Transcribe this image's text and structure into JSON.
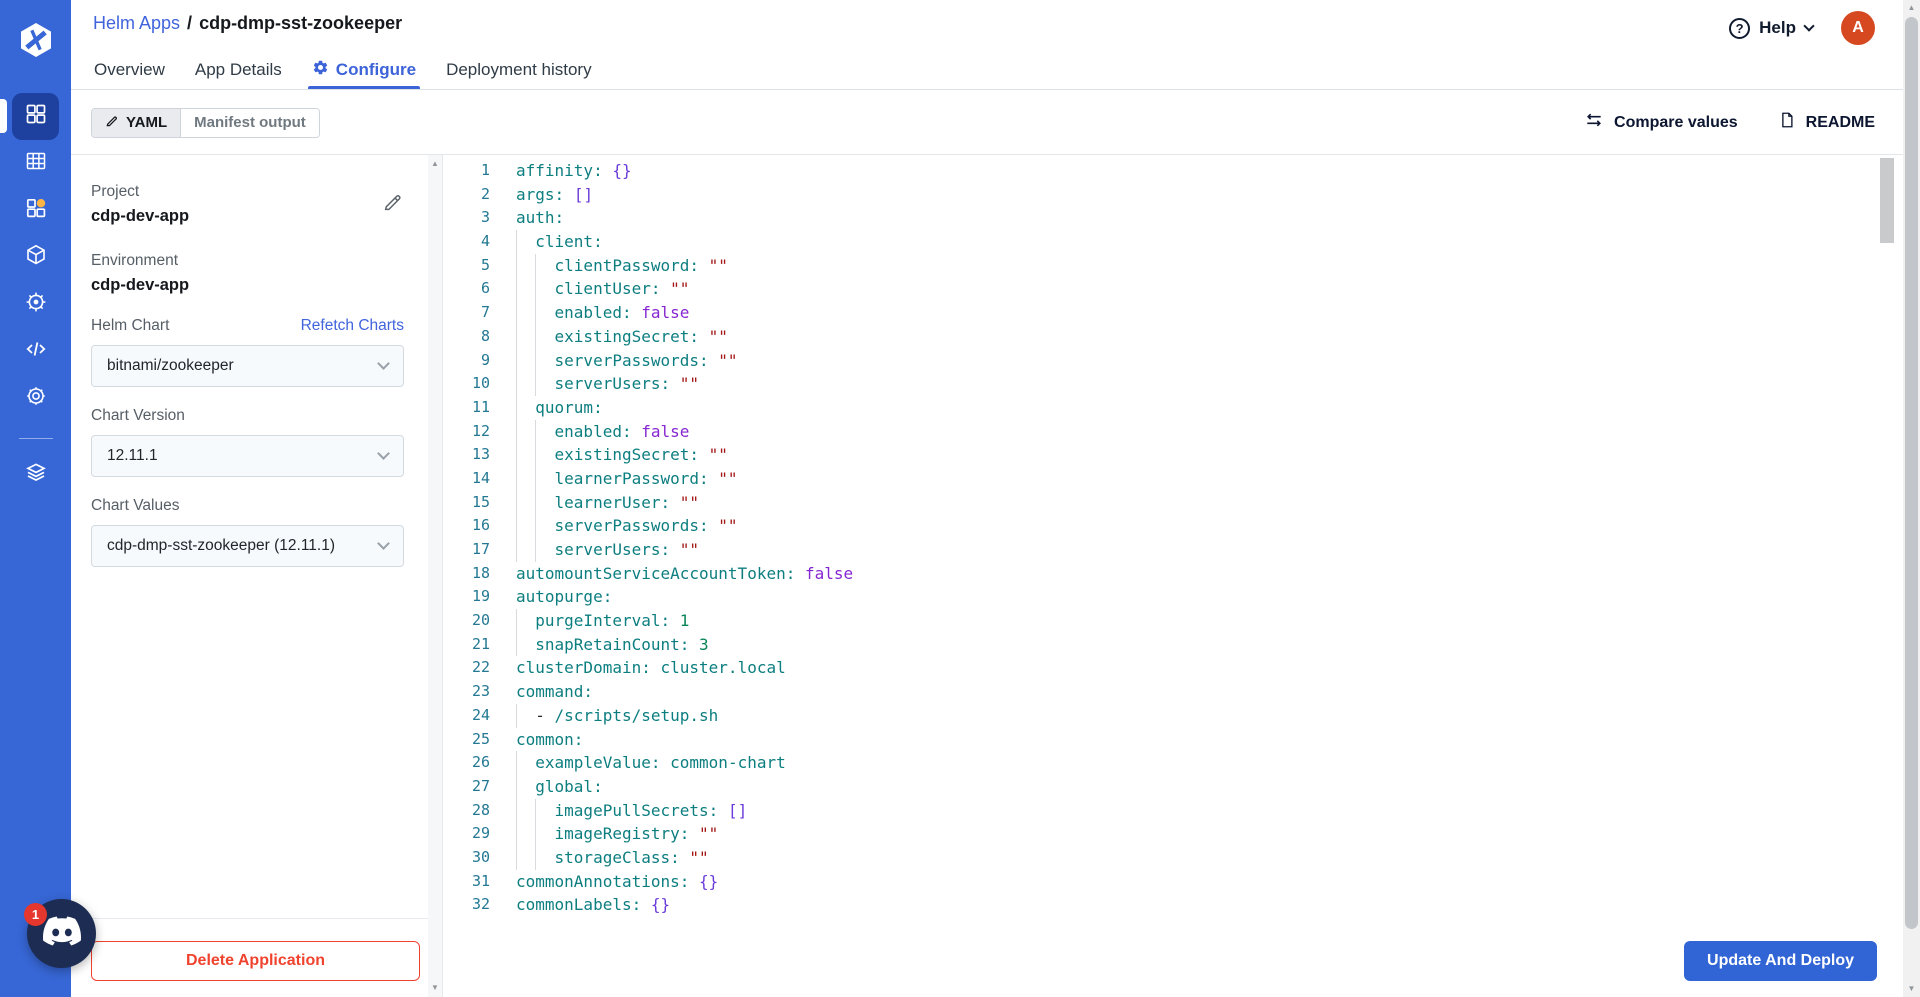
{
  "colors": {
    "rail_blue": "#3767d6",
    "rail_active": "#1e409e",
    "link_blue": "#4164dd",
    "tab_active": "#3d63d8",
    "deploy_blue": "#3165d6",
    "danger_red": "#f0432e",
    "avatar_orange": "#d6481f",
    "badge_red": "#e5372e",
    "notification_dot": "#ffb545",
    "yaml_key_teal": "#0d7e80",
    "yaml_string_red": "#a31515",
    "yaml_number_green": "#098658",
    "yaml_keyword_purple": "#8626d1",
    "yaml_bracket_purple": "#6a3bd8",
    "line_number": "#237893"
  },
  "icons": {
    "logo": "devtron-logo",
    "rail": [
      "apps-grid-icon",
      "jobs-table-icon",
      "chart-store-icon",
      "resource-cube-icon",
      "security-wheel-icon",
      "code-icon",
      "gear-icon",
      "stack-icon"
    ],
    "help_question": "?",
    "up_arrow": "▲",
    "down_arrow": "▼"
  },
  "header": {
    "breadcrumb": {
      "parent": "Helm Apps",
      "separator": "/",
      "current": "cdp-dmp-sst-zookeeper"
    },
    "help_label": "Help",
    "avatar_initial": "A"
  },
  "tabs": [
    {
      "label": "Overview",
      "active": false
    },
    {
      "label": "App Details",
      "active": false
    },
    {
      "label": "Configure",
      "active": true
    },
    {
      "label": "Deployment history",
      "active": false
    }
  ],
  "toolbar": {
    "yaml_label": "YAML",
    "manifest_label": "Manifest output",
    "compare_label": "Compare values",
    "readme_label": "README"
  },
  "panel": {
    "project_label": "Project",
    "project_value": "cdp-dev-app",
    "environment_label": "Environment",
    "environment_value": "cdp-dev-app",
    "helm_chart_label": "Helm Chart",
    "refetch_label": "Refetch Charts",
    "helm_chart_value": "bitnami/zookeeper",
    "chart_version_label": "Chart Version",
    "chart_version_value": "12.11.1",
    "chart_values_label": "Chart Values",
    "chart_values_value": "cdp-dmp-sst-zookeeper (12.11.1)",
    "delete_label": "Delete Application"
  },
  "footer": {
    "deploy_label": "Update And Deploy"
  },
  "floating": {
    "badge": "1"
  },
  "editor": {
    "lines": [
      {
        "indent": 0,
        "tokens": [
          [
            "k",
            "affinity:"
          ],
          [
            "t",
            " "
          ],
          [
            "b",
            "{}"
          ]
        ]
      },
      {
        "indent": 0,
        "tokens": [
          [
            "k",
            "args:"
          ],
          [
            "t",
            " "
          ],
          [
            "b",
            "[]"
          ]
        ]
      },
      {
        "indent": 0,
        "tokens": [
          [
            "k",
            "auth:"
          ]
        ]
      },
      {
        "indent": 1,
        "tokens": [
          [
            "k",
            "client:"
          ]
        ]
      },
      {
        "indent": 2,
        "tokens": [
          [
            "k",
            "clientPassword:"
          ],
          [
            "t",
            " "
          ],
          [
            "s",
            "\"\""
          ]
        ]
      },
      {
        "indent": 2,
        "tokens": [
          [
            "k",
            "clientUser:"
          ],
          [
            "t",
            " "
          ],
          [
            "s",
            "\"\""
          ]
        ]
      },
      {
        "indent": 2,
        "tokens": [
          [
            "k",
            "enabled:"
          ],
          [
            "t",
            " "
          ],
          [
            "w",
            "false"
          ]
        ]
      },
      {
        "indent": 2,
        "tokens": [
          [
            "k",
            "existingSecret:"
          ],
          [
            "t",
            " "
          ],
          [
            "s",
            "\"\""
          ]
        ]
      },
      {
        "indent": 2,
        "tokens": [
          [
            "k",
            "serverPasswords:"
          ],
          [
            "t",
            " "
          ],
          [
            "s",
            "\"\""
          ]
        ]
      },
      {
        "indent": 2,
        "tokens": [
          [
            "k",
            "serverUsers:"
          ],
          [
            "t",
            " "
          ],
          [
            "s",
            "\"\""
          ]
        ]
      },
      {
        "indent": 1,
        "tokens": [
          [
            "k",
            "quorum:"
          ]
        ]
      },
      {
        "indent": 2,
        "tokens": [
          [
            "k",
            "enabled:"
          ],
          [
            "t",
            " "
          ],
          [
            "w",
            "false"
          ]
        ]
      },
      {
        "indent": 2,
        "tokens": [
          [
            "k",
            "existingSecret:"
          ],
          [
            "t",
            " "
          ],
          [
            "s",
            "\"\""
          ]
        ]
      },
      {
        "indent": 2,
        "tokens": [
          [
            "k",
            "learnerPassword:"
          ],
          [
            "t",
            " "
          ],
          [
            "s",
            "\"\""
          ]
        ]
      },
      {
        "indent": 2,
        "tokens": [
          [
            "k",
            "learnerUser:"
          ],
          [
            "t",
            " "
          ],
          [
            "s",
            "\"\""
          ]
        ]
      },
      {
        "indent": 2,
        "tokens": [
          [
            "k",
            "serverPasswords:"
          ],
          [
            "t",
            " "
          ],
          [
            "s",
            "\"\""
          ]
        ]
      },
      {
        "indent": 2,
        "tokens": [
          [
            "k",
            "serverUsers:"
          ],
          [
            "t",
            " "
          ],
          [
            "s",
            "\"\""
          ]
        ]
      },
      {
        "indent": 0,
        "tokens": [
          [
            "k",
            "automountServiceAccountToken:"
          ],
          [
            "t",
            " "
          ],
          [
            "w",
            "false"
          ]
        ]
      },
      {
        "indent": 0,
        "tokens": [
          [
            "k",
            "autopurge:"
          ]
        ]
      },
      {
        "indent": 1,
        "tokens": [
          [
            "k",
            "purgeInterval:"
          ],
          [
            "t",
            " "
          ],
          [
            "n",
            "1"
          ]
        ]
      },
      {
        "indent": 1,
        "tokens": [
          [
            "k",
            "snapRetainCount:"
          ],
          [
            "t",
            " "
          ],
          [
            "n",
            "3"
          ]
        ]
      },
      {
        "indent": 0,
        "tokens": [
          [
            "k",
            "clusterDomain:"
          ],
          [
            "t",
            " "
          ],
          [
            "v",
            "cluster.local"
          ]
        ]
      },
      {
        "indent": 0,
        "tokens": [
          [
            "k",
            "command:"
          ]
        ]
      },
      {
        "indent": 1,
        "tokens": [
          [
            "t",
            "- "
          ],
          [
            "v",
            "/scripts/setup.sh"
          ]
        ]
      },
      {
        "indent": 0,
        "tokens": [
          [
            "k",
            "common:"
          ]
        ]
      },
      {
        "indent": 1,
        "tokens": [
          [
            "k",
            "exampleValue:"
          ],
          [
            "t",
            " "
          ],
          [
            "v",
            "common-chart"
          ]
        ]
      },
      {
        "indent": 1,
        "tokens": [
          [
            "k",
            "global:"
          ]
        ]
      },
      {
        "indent": 2,
        "tokens": [
          [
            "k",
            "imagePullSecrets:"
          ],
          [
            "t",
            " "
          ],
          [
            "b",
            "[]"
          ]
        ]
      },
      {
        "indent": 2,
        "tokens": [
          [
            "k",
            "imageRegistry:"
          ],
          [
            "t",
            " "
          ],
          [
            "s",
            "\"\""
          ]
        ]
      },
      {
        "indent": 2,
        "tokens": [
          [
            "k",
            "storageClass:"
          ],
          [
            "t",
            " "
          ],
          [
            "s",
            "\"\""
          ]
        ]
      },
      {
        "indent": 0,
        "tokens": [
          [
            "k",
            "commonAnnotations:"
          ],
          [
            "t",
            " "
          ],
          [
            "b",
            "{}"
          ]
        ]
      },
      {
        "indent": 0,
        "tokens": [
          [
            "k",
            "commonLabels:"
          ],
          [
            "t",
            " "
          ],
          [
            "b",
            "{}"
          ]
        ]
      }
    ]
  }
}
